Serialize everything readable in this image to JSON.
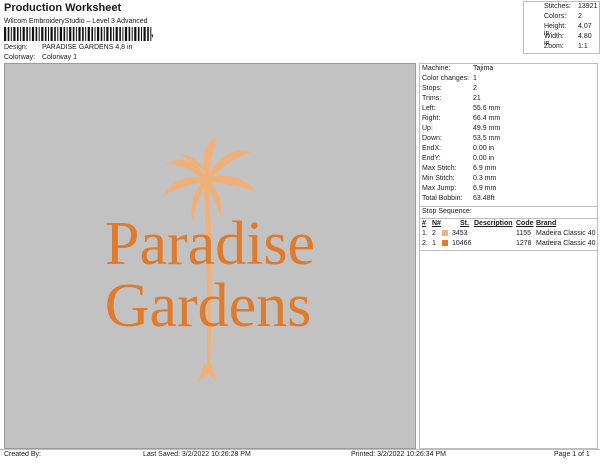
{
  "header": {
    "title": "Production Worksheet",
    "subtitle": "Wilcom EmbroideryStudio – Level 3 Advanced",
    "barcode_mark": ","
  },
  "meta": {
    "design_label": "Design:",
    "design_value": "PARADISE GARDENS 4,8 in",
    "colorway_label": "Colorway:",
    "colorway_value": "Colorway 1"
  },
  "stats": [
    {
      "label": "Stitches:",
      "value": "13921"
    },
    {
      "label": "Colors:",
      "value": "2"
    },
    {
      "label": "Height:",
      "value": "4.07 in"
    },
    {
      "label": "Width:",
      "value": "4.80 in"
    },
    {
      "label": "Zoom:",
      "value": "1:1"
    }
  ],
  "design": {
    "line1": "Paradise",
    "line2": "Gardens",
    "text_color": "#e07b2e",
    "palm_color": "#f0b07a",
    "bg_color": "#c2c2c2"
  },
  "properties": [
    {
      "label": "Machine:",
      "value": "Tajima"
    },
    {
      "label": "Color changes:",
      "value": "1"
    },
    {
      "label": "Stops:",
      "value": "2"
    },
    {
      "label": "Trims:",
      "value": "21"
    },
    {
      "label": "Left:",
      "value": "55.6 mm"
    },
    {
      "label": "Right:",
      "value": "66.4 mm"
    },
    {
      "label": "Up:",
      "value": "49.9 mm"
    },
    {
      "label": "Down:",
      "value": "53.5 mm"
    },
    {
      "label": "EndX:",
      "value": "0.00 in"
    },
    {
      "label": "EndY:",
      "value": "0.00 in"
    },
    {
      "label": "Max Stitch:",
      "value": "6.9 mm"
    },
    {
      "label": "Min Stitch:",
      "value": "0.3 mm"
    },
    {
      "label": "Max Jump:",
      "value": "6.9 mm"
    },
    {
      "label": "Total Bobbin:",
      "value": "63.48ft"
    }
  ],
  "stop_sequence": {
    "title": "Stop Sequence:",
    "headers": {
      "num": "#",
      "n": "N#",
      "st": "St.",
      "description": "Description",
      "code": "Code",
      "brand": "Brand"
    },
    "rows": [
      {
        "num": "1.",
        "n": "2",
        "color": "#f0b07a",
        "st": "3453",
        "description": "",
        "code": "1155",
        "brand": "Madeira Classic 40"
      },
      {
        "num": "2.",
        "n": "1",
        "color": "#e07b2e",
        "st": "10466",
        "description": "",
        "code": "1278",
        "brand": "Madeira Classic 40"
      }
    ]
  },
  "footer": {
    "created_by": "Created By:",
    "last_saved": "Last Saved: 3/2/2022 10:26:28 PM",
    "printed": "Printed: 3/2/2022 10:26:34 PM",
    "page": "Page 1 of 1"
  }
}
